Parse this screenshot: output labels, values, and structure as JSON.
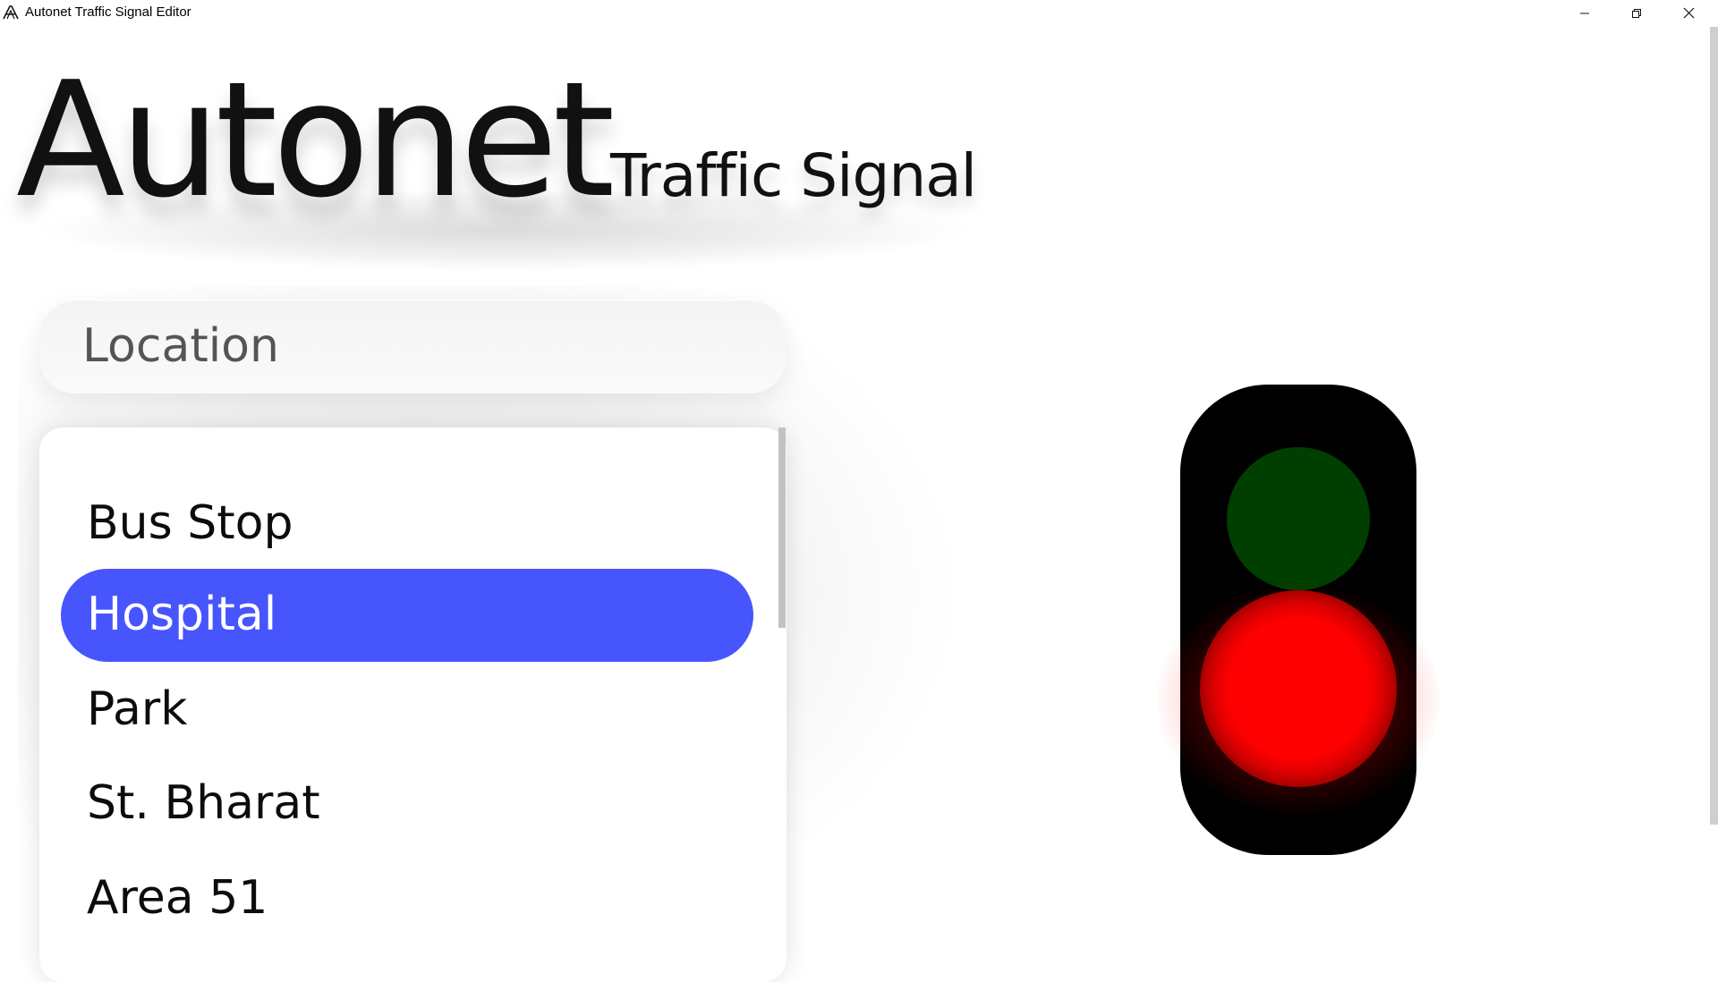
{
  "window": {
    "title": "Autonet Traffic Signal Editor",
    "icon": "autonet-logo-icon",
    "controls": [
      "minimize-icon",
      "restore-icon",
      "close-icon"
    ]
  },
  "branding": {
    "logo": "Autonet",
    "subtitle": "Traffic Signal"
  },
  "location": {
    "label": "Location"
  },
  "locations": {
    "items": [
      {
        "label": "Bus Stop",
        "selected": false
      },
      {
        "label": "Hospital",
        "selected": true
      },
      {
        "label": "Park",
        "selected": false
      },
      {
        "label": "St. Bharat",
        "selected": false
      },
      {
        "label": "Area 51",
        "selected": false
      }
    ],
    "selected_color": "#4755fc"
  },
  "signal": {
    "active_light": "red",
    "lights": [
      {
        "name": "green",
        "state": "off",
        "color": "#003f00"
      },
      {
        "name": "red",
        "state": "on",
        "color": "#ff0000"
      }
    ],
    "housing_color": "#000000"
  }
}
